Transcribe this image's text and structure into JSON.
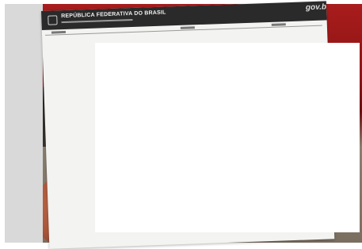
{
  "document": {
    "header_title": "REPÚBLICA FEDERATIVA DO BRASIL",
    "brand_logo": "gov.b"
  },
  "icons": {
    "emblem": "coat-of-arms-icon"
  }
}
